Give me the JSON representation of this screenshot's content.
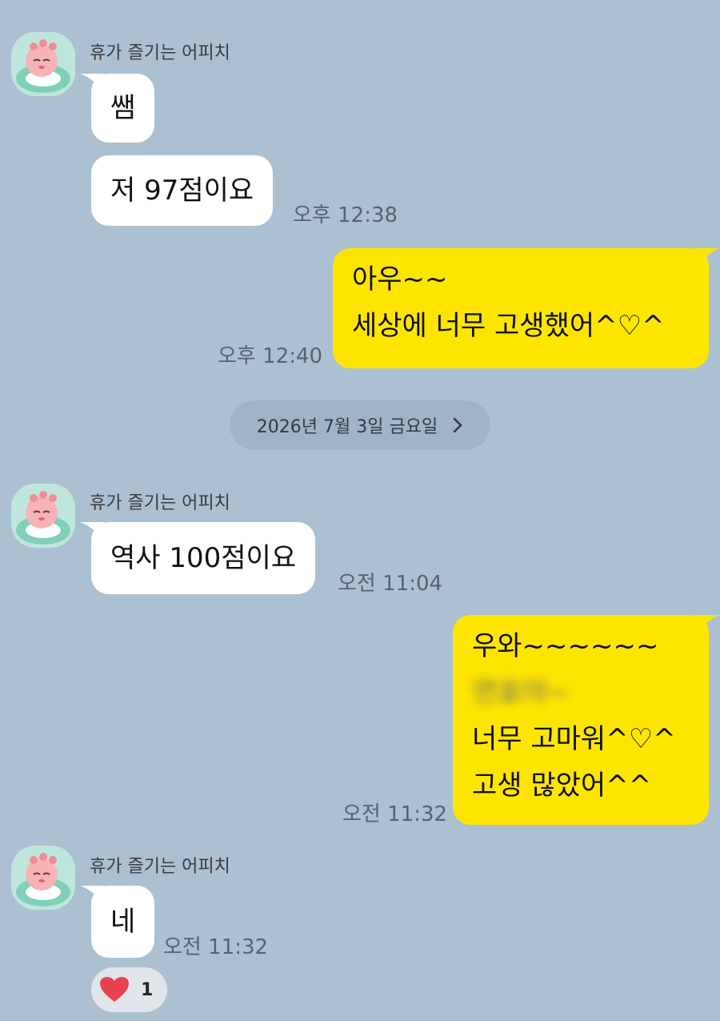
{
  "chat": {
    "sender_name": "휴가 즐기는 어피치",
    "date_divider": "2026년 7월 3일 금요일",
    "groups": [
      {
        "messages": [
          "쌤",
          "저 97점이요"
        ],
        "time": "오후 12:38"
      },
      {
        "outgoing_lines": [
          "아우~~",
          "세상에 너무 고생했어^♡^"
        ],
        "time": "오후 12:40"
      },
      {
        "messages": [
          "역사 100점이요"
        ],
        "time": "오전 11:04"
      },
      {
        "outgoing_lines": [
          "우와~~~~~~",
          "연효야~",
          "너무 고마워^♡^",
          "고생 많았어^^"
        ],
        "time": "오전 11:32"
      },
      {
        "messages": [
          "네"
        ],
        "time": "오전 11:32",
        "reaction": {
          "icon": "heart-icon",
          "count": "1"
        }
      }
    ]
  },
  "colors": {
    "background": "#abc1d1",
    "incoming": "#ffffff",
    "outgoing": "#fee500",
    "heart": "#e8414f"
  }
}
